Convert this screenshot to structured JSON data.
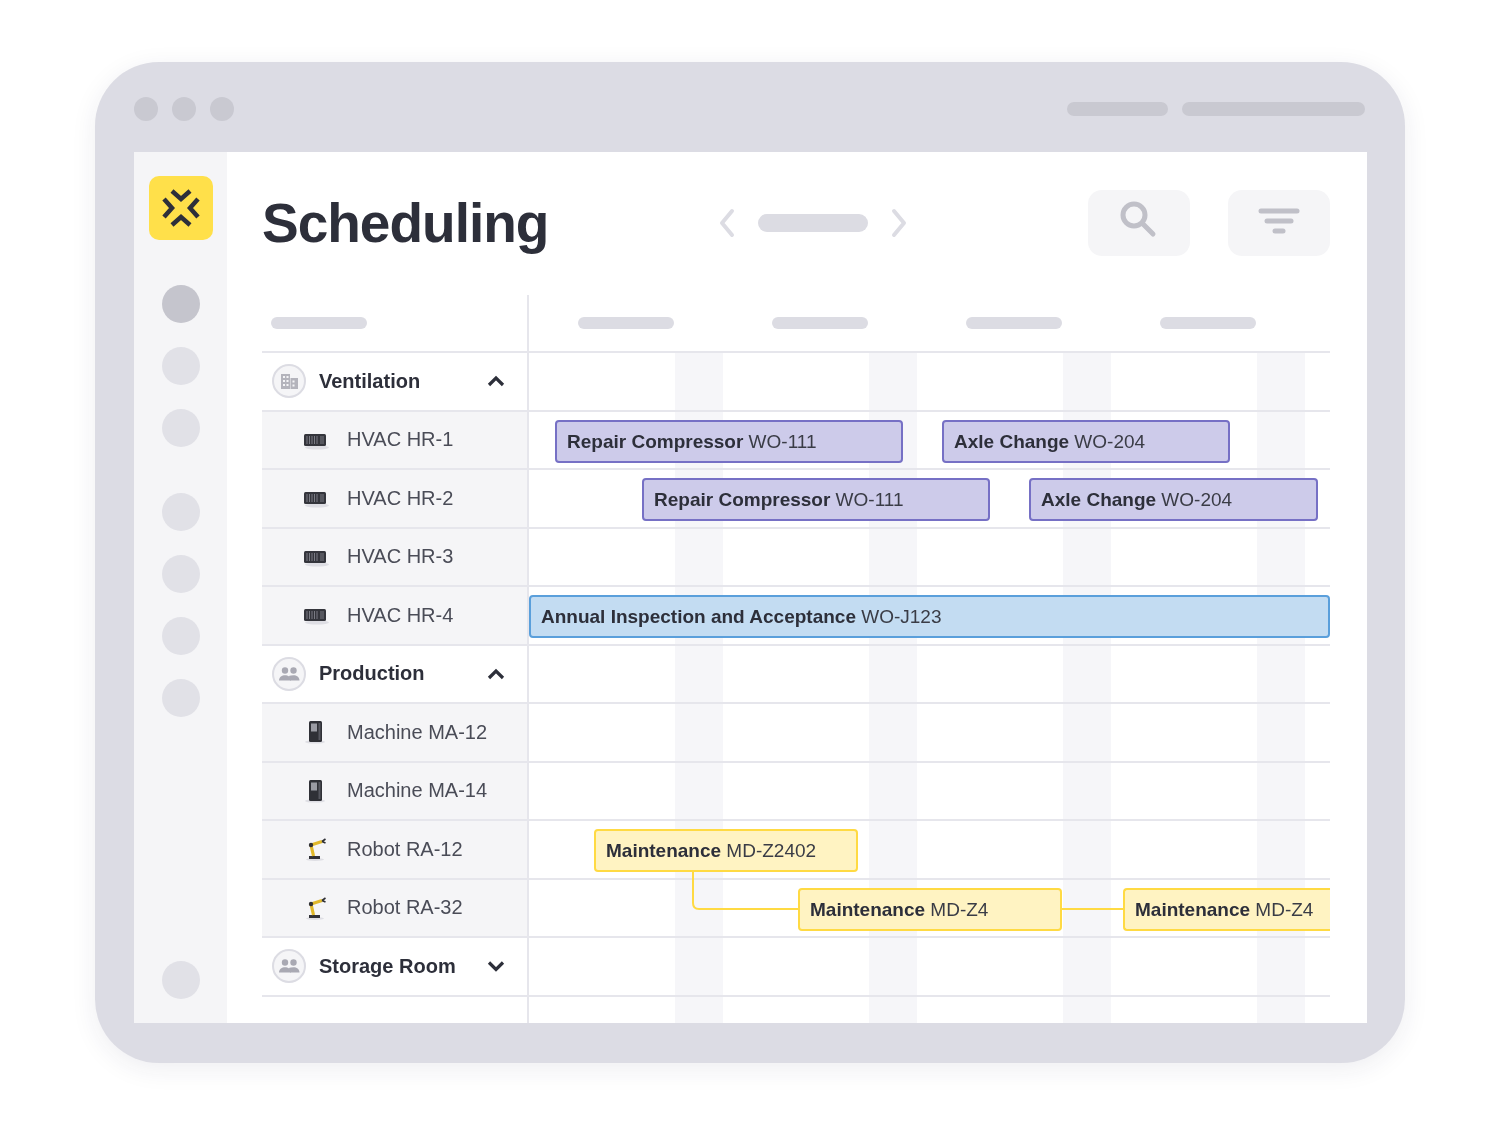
{
  "sidebar": {
    "sections": [
      {
        "items": [
          {
            "selected": true
          },
          {
            "selected": false
          },
          {
            "selected": false
          }
        ]
      },
      {
        "items": [
          {
            "selected": false
          },
          {
            "selected": false
          },
          {
            "selected": false
          },
          {
            "selected": false
          }
        ]
      }
    ],
    "bottom_items": [
      {
        "selected": false
      }
    ]
  },
  "header": {
    "title": "Scheduling"
  },
  "groups": [
    {
      "label": "Ventilation",
      "kind": "building",
      "expanded": true,
      "children": [
        {
          "label": "HVAC HR-1",
          "kind": "hvac",
          "tasks": [
            {
              "label": "**Repair Compressor** WO-111",
              "color": "#cdcbea",
              "linked": false
            },
            {
              "label": "**Axle Change** WO-204",
              "color": "#cdcbea",
              "linked": false
            }
          ]
        },
        {
          "label": "HVAC HR-2",
          "kind": "hvac",
          "tasks": [
            {
              "label": "**Repair Compressor** WO-111",
              "color": "#cdcbea",
              "linked": false
            },
            {
              "label": "**Axle Change** WO-204",
              "color": "#cdcbea",
              "linked": false
            }
          ]
        },
        {
          "label": "HVAC HR-3",
          "kind": "hvac"
        },
        {
          "label": "HVAC HR-4",
          "kind": "hvac",
          "tasks": [
            {
              "label": "**Annual Inspection and Acceptance** WO-J123",
              "color": "#c3dcf2",
              "linked": false
            }
          ]
        }
      ]
    },
    {
      "label": "Production",
      "kind": "people",
      "expanded": true,
      "children": [
        {
          "label": "Machine MA-12",
          "kind": "machine"
        },
        {
          "label": "Machine MA-14",
          "kind": "machine"
        },
        {
          "label": "Robot RA-12",
          "kind": "robot",
          "tasks": [
            {
              "label": "**Maintenance** MD-Z2402",
              "color": "#fff3c2",
              "linked": false
            }
          ]
        },
        {
          "label": "Robot RA-32",
          "kind": "robot",
          "tasks": [
            {
              "label": "**Maintenance** MD-Z4",
              "color": "#fff3c2",
              "linked": true
            },
            {
              "label": "**Maintenance** MD-Z4",
              "color": "#fff3c2",
              "linked": true
            }
          ]
        }
      ]
    },
    {
      "label": "Storage Room",
      "kind": "people",
      "expanded": false
    }
  ]
}
